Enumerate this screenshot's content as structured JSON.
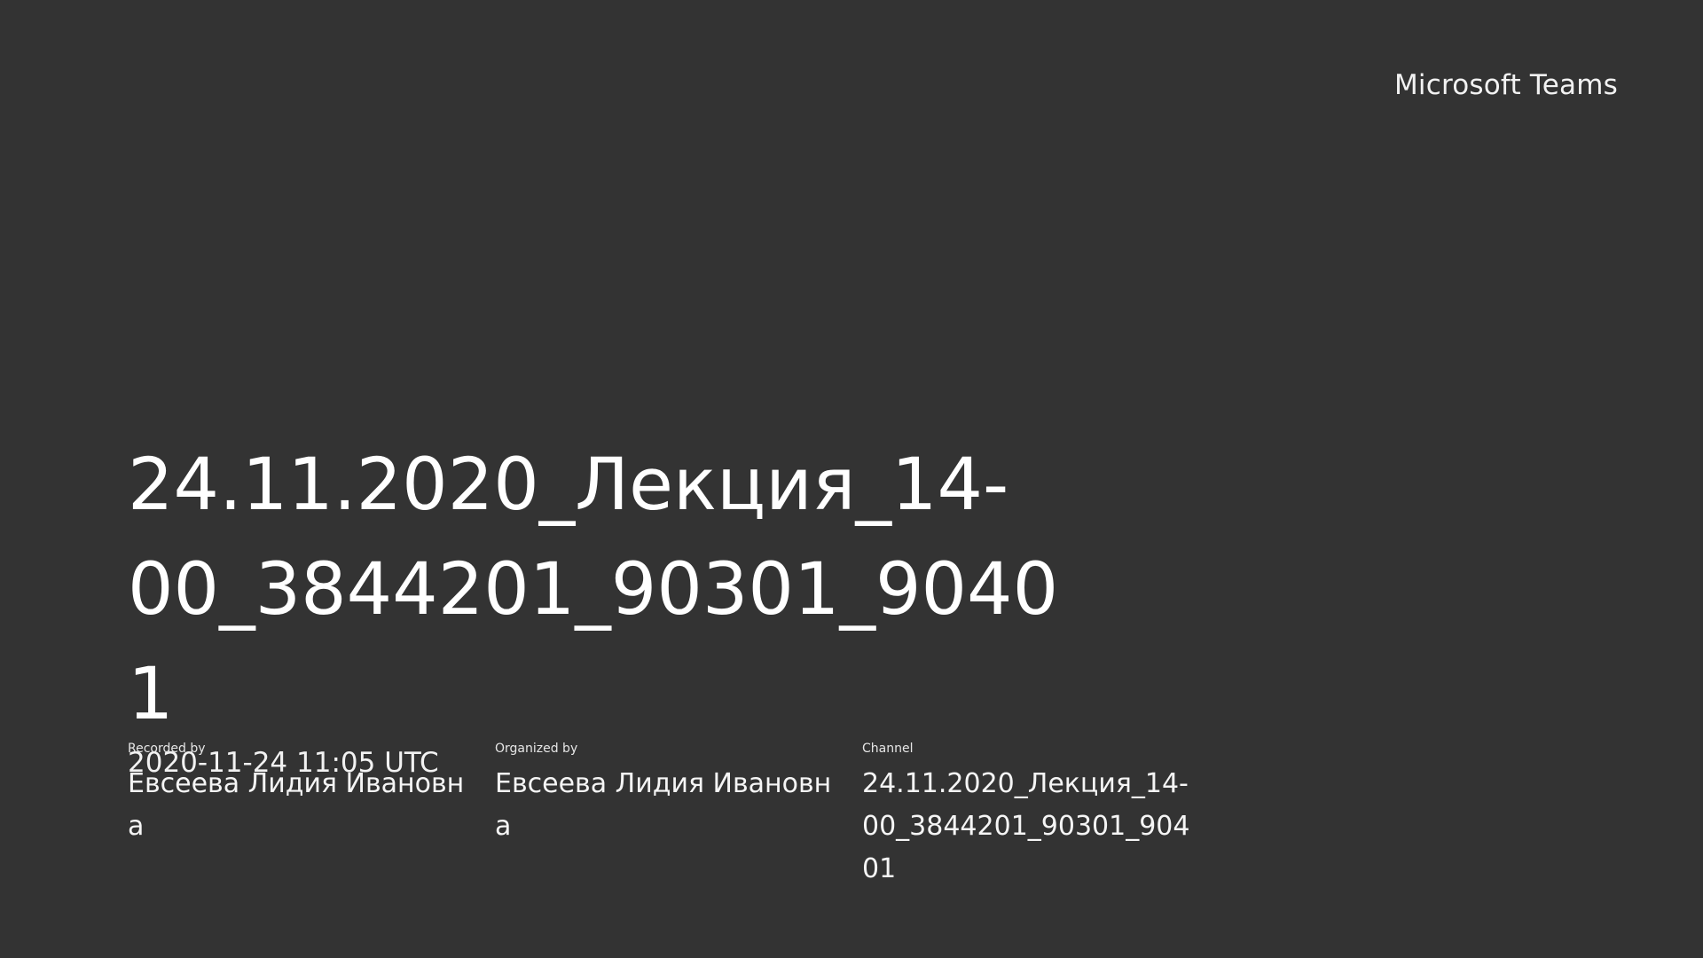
{
  "brand": {
    "label": "Microsoft Teams"
  },
  "recording": {
    "title": "24.11.2020_Лекция_14-00_3844201_90301_90401",
    "datetime": "2020-11-24 11:05 UTC"
  },
  "details": {
    "recorded_by": {
      "label": "Recorded by",
      "value": "Евсеева Лидия Ивановна"
    },
    "organized_by": {
      "label": "Organized by",
      "value": "Евсеева Лидия Ивановна"
    },
    "channel": {
      "label": "Channel",
      "value": "24.11.2020_Лекция_14-00_3844201_90301_90401"
    }
  },
  "colors": {
    "background": "#333333",
    "text": "#ffffff"
  }
}
